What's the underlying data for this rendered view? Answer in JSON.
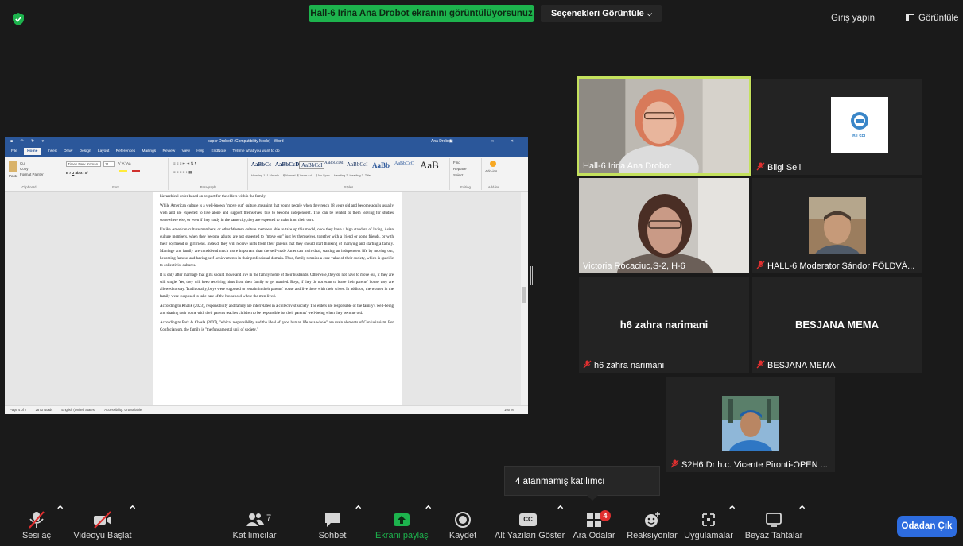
{
  "colors": {
    "share_banner": "#1db34d",
    "active_speaker_border": "#c4e15d",
    "leave_button": "#2d6cdf",
    "badge_red": "#e02f2f",
    "background": "#1a1a1a"
  },
  "topbar": {
    "share_banner": "Hall-6 Irina Ana Drobot ekranını görüntülüyorsunuz",
    "view_options": "Seçenekleri Görüntüle",
    "signin": "Giriş yapın",
    "view": "Görüntüle"
  },
  "word": {
    "title": "paper Drobot2 (Compatibility Mode) - Word",
    "user": "Ana Drobot",
    "tabs": [
      "File",
      "Home",
      "Insert",
      "Draw",
      "Design",
      "Layout",
      "References",
      "Mailings",
      "Review",
      "View",
      "Help",
      "EndNote",
      "Tell me what you want to do"
    ],
    "font_name": "Times New Roman",
    "font_size": "11",
    "clipboard": {
      "cut": "Cut",
      "copy": "Copy",
      "paste": "Paste",
      "format_painter": "Format Painter",
      "label": "Clipboard"
    },
    "group_labels": {
      "font": "Font",
      "paragraph": "Paragraph",
      "styles": "Styles",
      "editing": "Editing",
      "addins": "Add-ins"
    },
    "styles": [
      "Heading 1",
      "1 Makale...",
      "¶ Normal",
      "¶ Yazar Ad...",
      "¶ No Spac...",
      "Heading 2",
      "Heading 3",
      "Title"
    ],
    "editing": {
      "find": "Find",
      "replace": "Replace",
      "select": "Select"
    },
    "addins": "Add-ins",
    "paragraphs": [
      "hierarchical order based on respect for the elders within the family.",
      "While American culture is a well-known \"move out\" culture, meaning that young people when they reach 18 years old and become adults usually wish and are expected to live alone and support themselves, this to become independent. This can be related to them leaving for studies somewhere else, or even if they study in the same city, they are expected to make it on their own.",
      "Unlike American culture members, or other Western culture members able to take up this model, once they have a high standard of living, Asian culture members, when they become adults, are not expected to \"move out\" just by themselves, together with a friend or some friends, or with their boyfriend or girlfriend. Instead, they will receive hints from their parents that they should start thinking of marrying and starting a family. Marriage and family are considered much more important than the self-made American individual, starting an independent life by moving out, becoming famous and having self-achievements in their professional domain. Thus, family remains a core value of their society, which is specific to collectivist cultures.",
      "It is only after marriage that girls should move and live in the family home of their husbands. Otherwise, they do not have to move out, if they are still single. Yet, they will keep receiving hints from their family to get married. Boys, if they do not want to leave their parents' home, they are allowed to stay. Traditionally, boys were supposed to remain in their parents' house and live there with their wives. In addition, the women in the family were supposed to take care of the household where the men lived.",
      "According to Khalik (2023), responsibility and family are interrelated in a collectivist society. The elders are responsible of the family's well-being and sharing their home with their parents teaches children to be responsible for their parents' well-being when they become old.",
      "According to Park & Chesla (2007), \"ethical responsibility and the ideal of good human life as a whole\" are main elements of Confucianism. For Confucianism, the family is \"the fundamental unit of society,\""
    ],
    "status": {
      "page": "Page 4 of 7",
      "words": "2873 words",
      "language": "English (United States)",
      "accessibility": "Accessibility: Unavailable",
      "zoom": "100 %"
    }
  },
  "participants": [
    {
      "name": "Hall-6 Irina Ana Drobot",
      "muted": false,
      "video": true,
      "active": true
    },
    {
      "name": "Bilgi Seli",
      "muted": true,
      "video": false,
      "logo_text": "BİLSEL"
    },
    {
      "name": "Victoria Rocaciuc,S-2, H-6",
      "muted": false,
      "video": true
    },
    {
      "name": "HALL-6 Moderator Sándor FÖLDVÁ...",
      "muted": true,
      "video": false
    },
    {
      "name": "h6 zahra narimani",
      "muted": true,
      "video": false,
      "center_name": "h6 zahra narimani"
    },
    {
      "name": "BESJANA MEMA",
      "muted": true,
      "video": false,
      "center_name": "BESJANA MEMA"
    },
    {
      "name": "S2H6 Dr h.c. Vicente Pironti-OPEN ...",
      "muted": true,
      "video": false
    }
  ],
  "toast": "4 atanmamış katılımcı",
  "toolbar": {
    "mute": "Sesi aç",
    "video": "Videoyu Başlat",
    "participants": "Katılımcılar",
    "participants_count": "7",
    "chat": "Sohbet",
    "share": "Ekranı paylaş",
    "record": "Kaydet",
    "captions": "Alt Yazıları Göster",
    "captions_icon_text": "CC",
    "breakout": "Ara Odalar",
    "breakout_badge": "4",
    "reactions": "Reaksiyonlar",
    "apps": "Uygulamalar",
    "whiteboard": "Beyaz Tahtalar",
    "leave": "Odadan Çık"
  }
}
